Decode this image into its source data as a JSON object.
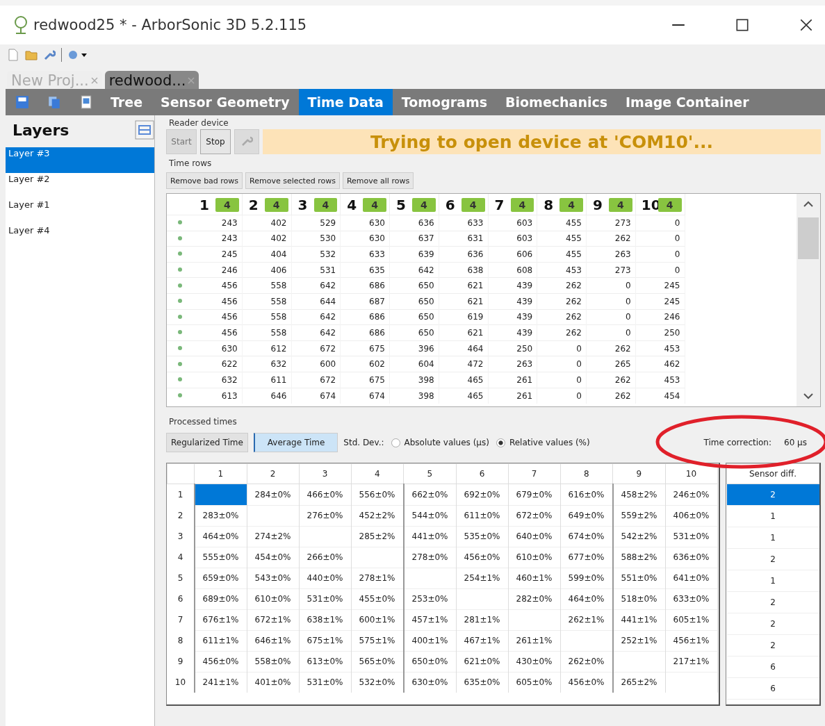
{
  "window": {
    "title": "redwood25 * - ArborSonic 3D 5.2.115"
  },
  "doc_tabs": [
    {
      "label": "New Proj...",
      "selected": false
    },
    {
      "label": "redwood...",
      "selected": true
    }
  ],
  "nav_tabs": [
    {
      "label": "Tree",
      "selected": false
    },
    {
      "label": "Sensor Geometry",
      "selected": false
    },
    {
      "label": "Time Data",
      "selected": true
    },
    {
      "label": "Tomograms",
      "selected": false
    },
    {
      "label": "Biomechanics",
      "selected": false
    },
    {
      "label": "Image Container",
      "selected": false
    }
  ],
  "layers": {
    "title": "Layers",
    "items": [
      {
        "label": "Layer #3",
        "selected": true
      },
      {
        "label": "Layer #2",
        "selected": false
      },
      {
        "label": "Layer #1",
        "selected": false
      },
      {
        "label": "Layer #4",
        "selected": false
      }
    ]
  },
  "reader_device": {
    "title": "Reader device",
    "buttons": [
      {
        "label": "Start",
        "disabled": true
      },
      {
        "label": "Stop",
        "disabled": false
      }
    ],
    "tool_disabled": true,
    "status": "Trying to open device at 'COM10'..."
  },
  "time_rows": {
    "title": "Time rows",
    "buttons": [
      "Remove bad rows",
      "Remove selected rows",
      "Remove all rows"
    ],
    "columns": [
      {
        "label": "1",
        "count": "4"
      },
      {
        "label": "2",
        "count": "4"
      },
      {
        "label": "3",
        "count": "4"
      },
      {
        "label": "4",
        "count": "4"
      },
      {
        "label": "5",
        "count": "4"
      },
      {
        "label": "6",
        "count": "4"
      },
      {
        "label": "7",
        "count": "4"
      },
      {
        "label": "8",
        "count": "4"
      },
      {
        "label": "9",
        "count": "4"
      },
      {
        "label": "10",
        "count": "4"
      }
    ],
    "rows": [
      [
        "243",
        "402",
        "529",
        "630",
        "636",
        "633",
        "603",
        "455",
        "273",
        "0"
      ],
      [
        "243",
        "402",
        "530",
        "630",
        "637",
        "631",
        "603",
        "455",
        "262",
        "0"
      ],
      [
        "245",
        "404",
        "532",
        "633",
        "639",
        "636",
        "606",
        "455",
        "263",
        "0"
      ],
      [
        "246",
        "406",
        "531",
        "635",
        "642",
        "638",
        "608",
        "453",
        "273",
        "0"
      ],
      [
        "456",
        "558",
        "642",
        "686",
        "650",
        "621",
        "439",
        "262",
        "0",
        "245"
      ],
      [
        "456",
        "558",
        "644",
        "687",
        "650",
        "621",
        "439",
        "262",
        "0",
        "245"
      ],
      [
        "456",
        "558",
        "642",
        "686",
        "650",
        "619",
        "439",
        "262",
        "0",
        "246"
      ],
      [
        "456",
        "558",
        "642",
        "686",
        "650",
        "621",
        "439",
        "262",
        "0",
        "250"
      ],
      [
        "630",
        "612",
        "672",
        "675",
        "396",
        "464",
        "250",
        "0",
        "262",
        "453"
      ],
      [
        "622",
        "632",
        "600",
        "602",
        "604",
        "472",
        "263",
        "0",
        "265",
        "462"
      ],
      [
        "632",
        "611",
        "672",
        "675",
        "398",
        "465",
        "261",
        "0",
        "262",
        "453"
      ],
      [
        "613",
        "646",
        "674",
        "674",
        "398",
        "465",
        "261",
        "0",
        "262",
        "454"
      ]
    ]
  },
  "processed_times": {
    "title": "Processed times",
    "modes": [
      {
        "label": "Regularized Time",
        "selected": false
      },
      {
        "label": "Average Time",
        "selected": true
      }
    ],
    "std_dev_label": "Std. Dev.:",
    "std_dev_options": [
      {
        "label": "Absolute values (µs)",
        "selected": false
      },
      {
        "label": "Relative values (%)",
        "selected": true
      }
    ],
    "time_correction_label": "Time correction:",
    "time_correction_value": "60 µs",
    "columns": [
      "1",
      "2",
      "3",
      "4",
      "5",
      "6",
      "7",
      "8",
      "9",
      "10"
    ],
    "rows": [
      {
        "label": "1",
        "selected": true,
        "cells": [
          null,
          "284±0%",
          "466±0%",
          "556±0%",
          "662±0%",
          "692±0%",
          "679±0%",
          "616±0%",
          "458±2%",
          "246±0%"
        ]
      },
      {
        "label": "2",
        "selected": false,
        "cells": [
          "283±0%",
          null,
          "276±0%",
          "452±2%",
          "544±0%",
          "611±0%",
          "672±0%",
          "649±0%",
          "559±2%",
          "406±0%"
        ]
      },
      {
        "label": "3",
        "selected": false,
        "cells": [
          "464±0%",
          "274±2%",
          null,
          "285±2%",
          "441±0%",
          "535±0%",
          "640±0%",
          "674±0%",
          "542±2%",
          "531±0%"
        ]
      },
      {
        "label": "4",
        "selected": false,
        "cells": [
          "555±0%",
          "454±0%",
          "266±0%",
          null,
          "278±0%",
          "456±0%",
          "610±0%",
          "677±0%",
          "588±2%",
          "636±0%"
        ]
      },
      {
        "label": "5",
        "selected": false,
        "cells": [
          "659±0%",
          "543±0%",
          "440±0%",
          "278±1%",
          null,
          "254±1%",
          "460±1%",
          "599±0%",
          "551±0%",
          "641±0%"
        ]
      },
      {
        "label": "6",
        "selected": false,
        "cells": [
          "689±0%",
          "610±0%",
          "531±0%",
          "455±0%",
          "253±0%",
          null,
          "282±0%",
          "464±0%",
          "518±0%",
          "633±0%"
        ]
      },
      {
        "label": "7",
        "selected": false,
        "cells": [
          "676±1%",
          "672±1%",
          "638±1%",
          "600±1%",
          "457±1%",
          "281±1%",
          null,
          "262±1%",
          "441±1%",
          "605±1%"
        ]
      },
      {
        "label": "8",
        "selected": false,
        "cells": [
          "611±1%",
          "646±1%",
          "675±1%",
          "575±1%",
          "400±1%",
          "467±1%",
          "261±1%",
          null,
          "252±1%",
          "456±1%"
        ]
      },
      {
        "label": "9",
        "selected": false,
        "cells": [
          "456±0%",
          "558±0%",
          "613±0%",
          "565±0%",
          "650±0%",
          "621±0%",
          "430±0%",
          "262±0%",
          null,
          "217±1%"
        ]
      },
      {
        "label": "10",
        "selected": false,
        "cells": [
          "241±1%",
          "401±0%",
          "531±0%",
          "532±0%",
          "630±0%",
          "635±0%",
          "605±0%",
          "456±0%",
          "265±2%",
          null
        ]
      }
    ],
    "side_table": {
      "header": "Sensor diff.",
      "rows": [
        {
          "value": "2",
          "selected": true
        },
        {
          "value": "1",
          "selected": false
        },
        {
          "value": "1",
          "selected": false
        },
        {
          "value": "2",
          "selected": false
        },
        {
          "value": "1",
          "selected": false
        },
        {
          "value": "2",
          "selected": false
        },
        {
          "value": "2",
          "selected": false
        },
        {
          "value": "2",
          "selected": false
        },
        {
          "value": "6",
          "selected": false
        },
        {
          "value": "6",
          "selected": false
        }
      ]
    }
  }
}
